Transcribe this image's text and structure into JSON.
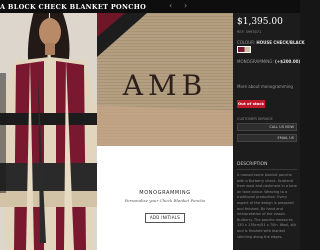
{
  "header": {
    "title": "A BLOCK CHECK BLANKET PONCHO",
    "prev_icon": "chevron-left-icon",
    "next_icon": "chevron-right-icon"
  },
  "gallery": {
    "monogram_text": "AMB",
    "panel_title": "MONOGRAMMING",
    "panel_caption": "Personalise your Check Blanket Poncho",
    "add_button_label": "ADD INITIALS"
  },
  "product": {
    "price": "$1,395.00",
    "ref": "REF: 3993071",
    "colour_label": "COLOUR:",
    "colour_value": "HOUSE CHECK/BLACK",
    "monogram_option_label": "MONOGRAMMING:",
    "monogram_option_value": "(+$200.00)",
    "link_label": "More about monogramming",
    "stock_status": "Out of stock",
    "customer_service_label": "CUSTOMER SERVICE",
    "call_button": "CALL US NOW",
    "email_button": "EMAIL US"
  },
  "description": {
    "heading": "DESCRIPTION",
    "text": "A monochrome blanket poncho with a Burberry check. Scotland from wool and cashmere in a tone on tone colour. Weaving to a traditional production. Every aspect of the design is prepared and finished. By hand and interpretation of the classic. Burberry. The poncho measures 130 x 178cm/51 x 70in. Wool, silk and is finished with blanket stitching along the edges."
  },
  "colors": {
    "accent_red": "#c0192c",
    "check_burgundy": "#7a1830",
    "check_camel": "#d2c3a7",
    "page_bg": "#161616"
  }
}
